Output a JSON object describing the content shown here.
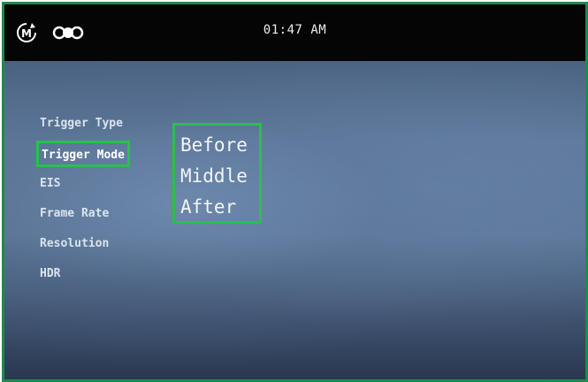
{
  "status_bar": {
    "time": "01:47 AM",
    "mode_icon": "manual-mode-icon",
    "camera_icon": "multi-camera-icon",
    "mode_letter": "M"
  },
  "menu": {
    "items": [
      {
        "label": "Trigger Type",
        "selected": false
      },
      {
        "label": "Trigger Mode",
        "selected": true
      },
      {
        "label": "EIS",
        "selected": false
      },
      {
        "label": "Frame Rate",
        "selected": false
      },
      {
        "label": "Resolution",
        "selected": false
      },
      {
        "label": "HDR",
        "selected": false
      }
    ]
  },
  "options": {
    "items": [
      "Before",
      "Middle",
      "After"
    ]
  },
  "colors": {
    "highlight": "#27c24a",
    "frame_border": "#1e8a4e"
  }
}
